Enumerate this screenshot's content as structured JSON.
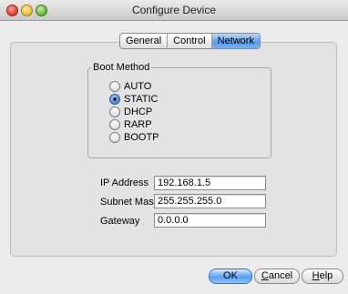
{
  "window": {
    "title": "Configure Device"
  },
  "tabs": [
    {
      "label": "General",
      "selected": false
    },
    {
      "label": "Control",
      "selected": false
    },
    {
      "label": "Network",
      "selected": true
    }
  ],
  "boot_method": {
    "label": "Boot Method",
    "options": [
      "AUTO",
      "STATIC",
      "DHCP",
      "RARP",
      "BOOTP"
    ],
    "selected": "STATIC"
  },
  "fields": {
    "ip": {
      "label": "IP Address",
      "value": "192.168.1.5"
    },
    "subnet": {
      "label": "Subnet Mask",
      "value": "255.255.255.0"
    },
    "gateway": {
      "label": "Gateway",
      "value": "0.0.0.0"
    }
  },
  "buttons": {
    "ok": "OK",
    "cancel_prefix": "C",
    "cancel_rest": "ancel",
    "help_prefix": "H",
    "help_rest": "elp"
  },
  "colors": {
    "accent": "#5a9be9"
  }
}
